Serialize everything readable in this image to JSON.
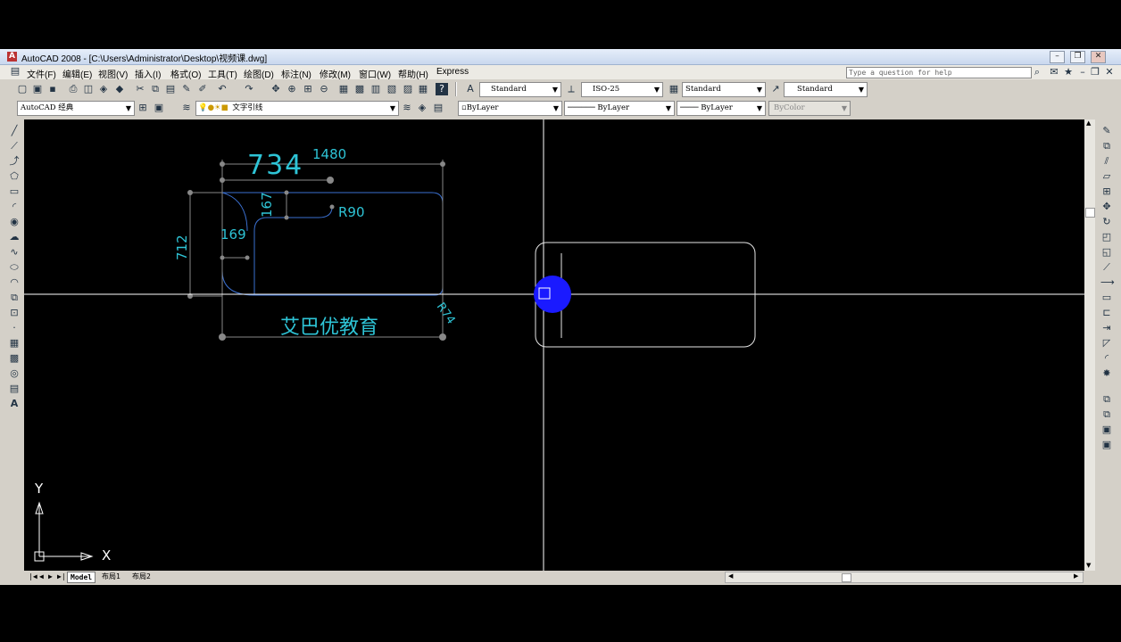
{
  "window": {
    "title": "AutoCAD 2008 - [C:\\Users\\Administrator\\Desktop\\视频课.dwg]"
  },
  "menu": {
    "items": [
      "文件(F)",
      "编辑(E)",
      "视图(V)",
      "插入(I)",
      "格式(O)",
      "工具(T)",
      "绘图(D)",
      "标注(N)",
      "修改(M)",
      "窗口(W)",
      "帮助(H)",
      "Express"
    ],
    "help_placeholder": "Type a question for help"
  },
  "toolbar": {
    "text_style": "Standard",
    "dim_style": "ISO-25",
    "table_style": "Standard",
    "multileader_style": "Standard",
    "workspace": "AutoCAD 经典",
    "layer": "文字引线",
    "color": "ByLayer",
    "linetype": "ByLayer",
    "lineweight": "ByLayer",
    "plotstyle": "ByColor"
  },
  "drawing": {
    "dim_734": "734",
    "dim_1480": "1480",
    "dim_167": "167",
    "dim_r90": "R90",
    "dim_712": "712",
    "dim_169": "169",
    "dim_r74": "R74",
    "watermark": "艾巴优教育"
  },
  "ucs": {
    "x_label": "X",
    "y_label": "Y"
  },
  "tabs": [
    "Model",
    "布局1",
    "布局2"
  ],
  "colors": {
    "dimension": "#2ec4d6",
    "crosshair": "#ffffff",
    "cursor_highlight": "#1a1aff",
    "canvas": "#000000"
  }
}
